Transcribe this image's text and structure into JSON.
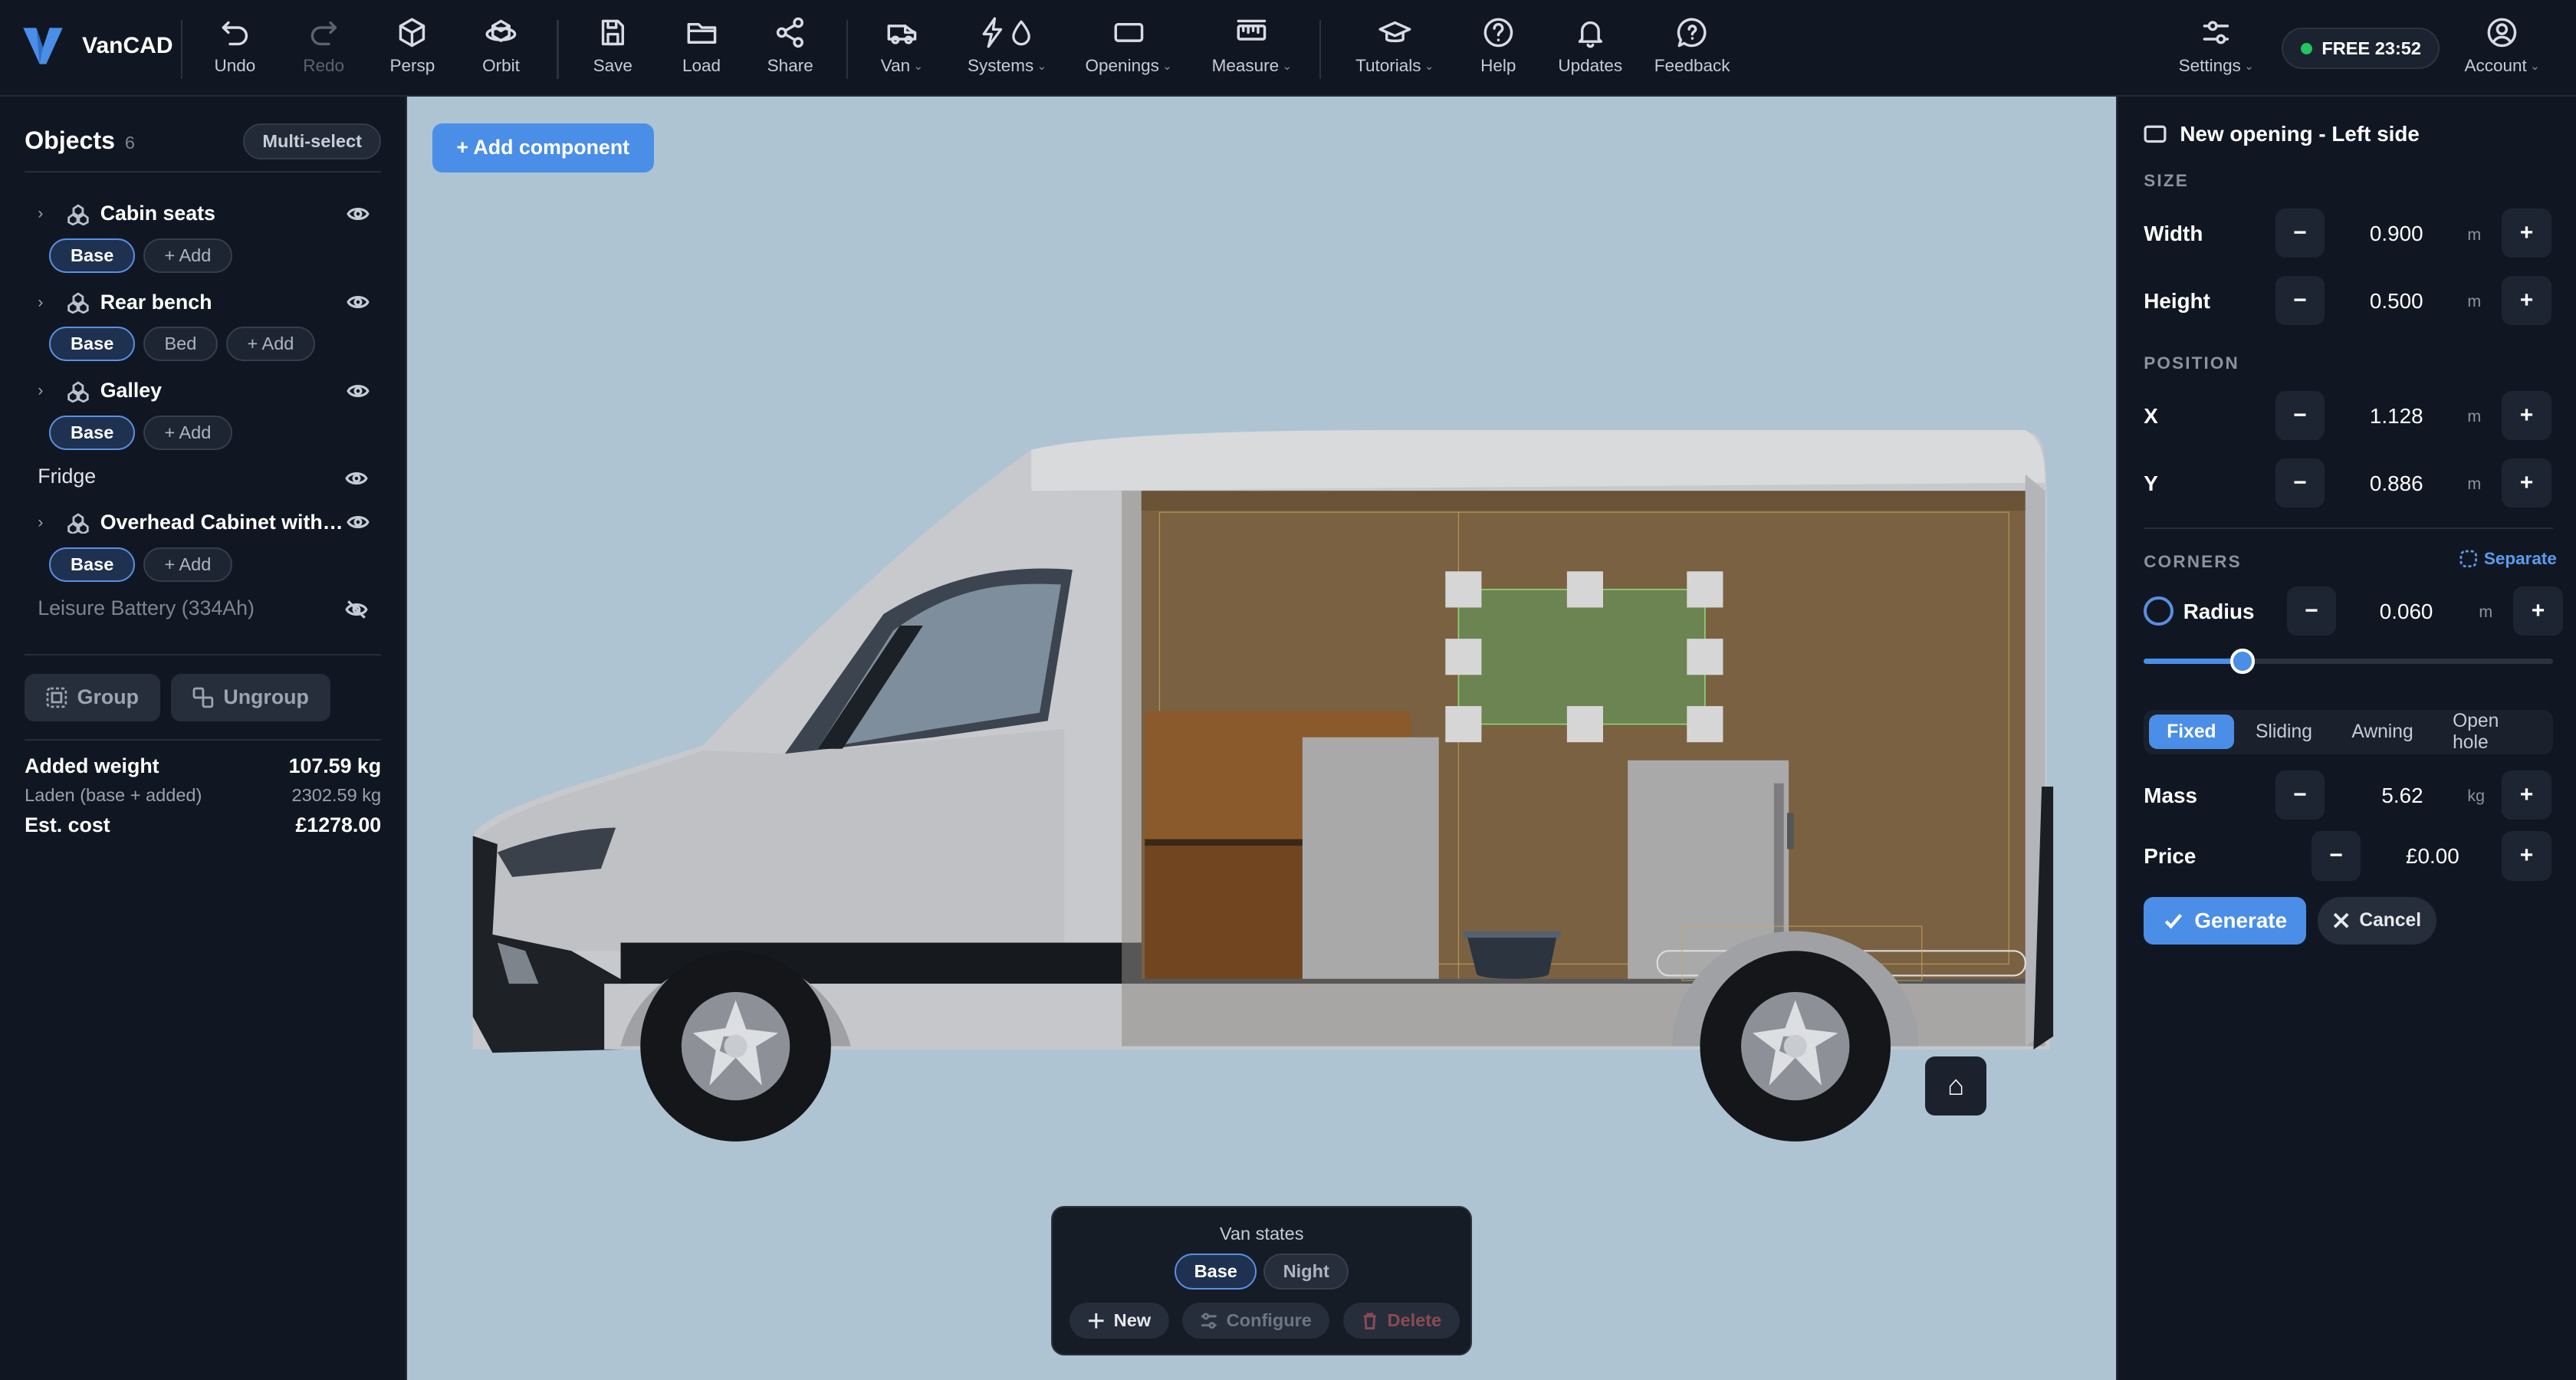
{
  "app": {
    "name": "VanCAD"
  },
  "toolbar": {
    "undo": "Undo",
    "redo": "Redo",
    "persp": "Persp",
    "orbit": "Orbit",
    "save": "Save",
    "load": "Load",
    "share": "Share",
    "van": "Van",
    "systems": "Systems",
    "openings": "Openings",
    "measure": "Measure",
    "tutorials": "Tutorials",
    "help": "Help",
    "updates": "Updates",
    "feedback": "Feedback",
    "settings": "Settings",
    "plan": "FREE 23:52",
    "account": "Account"
  },
  "objects": {
    "title": "Objects",
    "count": "6",
    "multiselect": "Multi-select",
    "items": [
      {
        "name": "Cabin seats",
        "chips": [
          "Base",
          "+ Add"
        ]
      },
      {
        "name": "Rear bench",
        "chips": [
          "Base",
          "Bed",
          "+ Add"
        ]
      },
      {
        "name": "Galley",
        "chips": [
          "Base",
          "+ Add"
        ]
      },
      {
        "name": "Fridge"
      },
      {
        "name": "Overhead Cabinet with …",
        "chips": [
          "Base",
          "+ Add"
        ]
      },
      {
        "name": "Leisure Battery (334Ah)",
        "hidden": true
      }
    ],
    "group": "Group",
    "ungroup": "Ungroup"
  },
  "weights": {
    "added_label": "Added weight",
    "added_value": "107.59 kg",
    "laden_label": "Laden (base + added)",
    "laden_value": "2302.59 kg",
    "cost_label": "Est. cost",
    "cost_value": "£1278.00"
  },
  "viewport": {
    "add_component": "+ Add component",
    "home_icon": "⌂",
    "states": {
      "title": "Van states",
      "base": "Base",
      "night": "Night",
      "new": "New",
      "configure": "Configure",
      "delete": "Delete"
    }
  },
  "panel": {
    "title": "New opening - Left side",
    "size_label": "SIZE",
    "width_label": "Width",
    "width_value": "0.900",
    "width_unit": "m",
    "height_label": "Height",
    "height_value": "0.500",
    "height_unit": "m",
    "position_label": "POSITION",
    "x_label": "X",
    "x_value": "1.128",
    "x_unit": "m",
    "y_label": "Y",
    "y_value": "0.886",
    "y_unit": "m",
    "corners_label": "CORNERS",
    "separate": "Separate",
    "radius_label": "Radius",
    "radius_value": "0.060",
    "radius_unit": "m",
    "radius_slider_fraction": 0.24,
    "types": [
      "Fixed",
      "Sliding",
      "Awning",
      "Open hole"
    ],
    "selected_type": "Fixed",
    "mass_label": "Mass",
    "mass_value": "5.62",
    "mass_unit": "kg",
    "price_label": "Price",
    "price_value": "£0.00",
    "generate": "Generate",
    "cancel": "Cancel"
  },
  "colors": {
    "accent": "#4a8ee8",
    "background": "#111722",
    "viewport": "#aec4d3",
    "status_dot": "#22c55e"
  }
}
